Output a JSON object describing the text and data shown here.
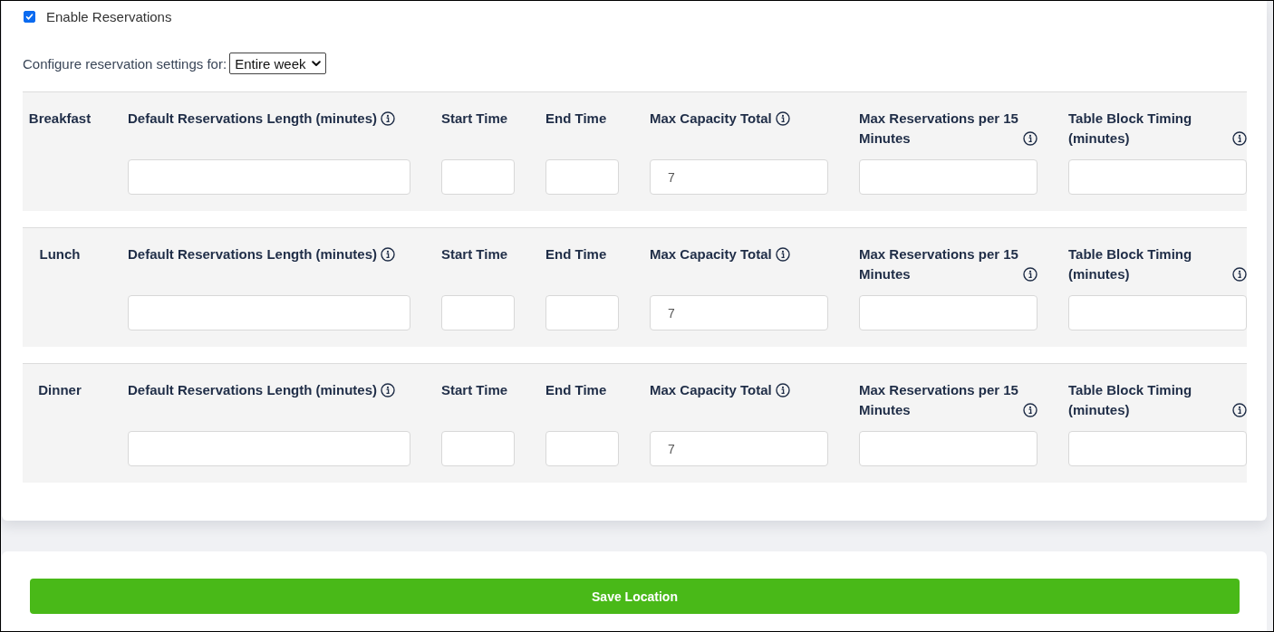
{
  "enable_reservations": {
    "label": "Enable Reservations",
    "checked": true
  },
  "configure": {
    "label": "Configure reservation settings for:",
    "selected_option": "Entire week"
  },
  "meals": [
    {
      "name": "Breakfast",
      "fields": [
        {
          "label": "Default Reservations Length (minutes)",
          "info_icon": true
        },
        {
          "label": "Start Time",
          "info_icon": false
        },
        {
          "label": "End Time",
          "info_icon": false
        },
        {
          "label": "Max Capacity Total",
          "info_icon": true,
          "value": "7"
        },
        {
          "label": "Max Reservations per 15 Minutes",
          "info_icon": true
        },
        {
          "label": "Table Block Timing (minutes)",
          "info_icon": true
        }
      ]
    },
    {
      "name": "Lunch",
      "fields": [
        {
          "label": "Default Reservations Length (minutes)",
          "info_icon": true
        },
        {
          "label": "Start Time",
          "info_icon": false
        },
        {
          "label": "End Time",
          "info_icon": false
        },
        {
          "label": "Max Capacity Total",
          "info_icon": true,
          "value": "7"
        },
        {
          "label": "Max Reservations per 15 Minutes",
          "info_icon": true
        },
        {
          "label": "Table Block Timing (minutes)",
          "info_icon": true
        }
      ]
    },
    {
      "name": "Dinner",
      "fields": [
        {
          "label": "Default Reservations Length (minutes)",
          "info_icon": true
        },
        {
          "label": "Start Time",
          "info_icon": false
        },
        {
          "label": "End Time",
          "info_icon": false
        },
        {
          "label": "Max Capacity Total",
          "info_icon": true,
          "value": "7"
        },
        {
          "label": "Max Reservations per 15 Minutes",
          "info_icon": true
        },
        {
          "label": "Table Block Timing (minutes)",
          "info_icon": true
        }
      ]
    }
  ],
  "save_button": {
    "label": "Save Location"
  }
}
